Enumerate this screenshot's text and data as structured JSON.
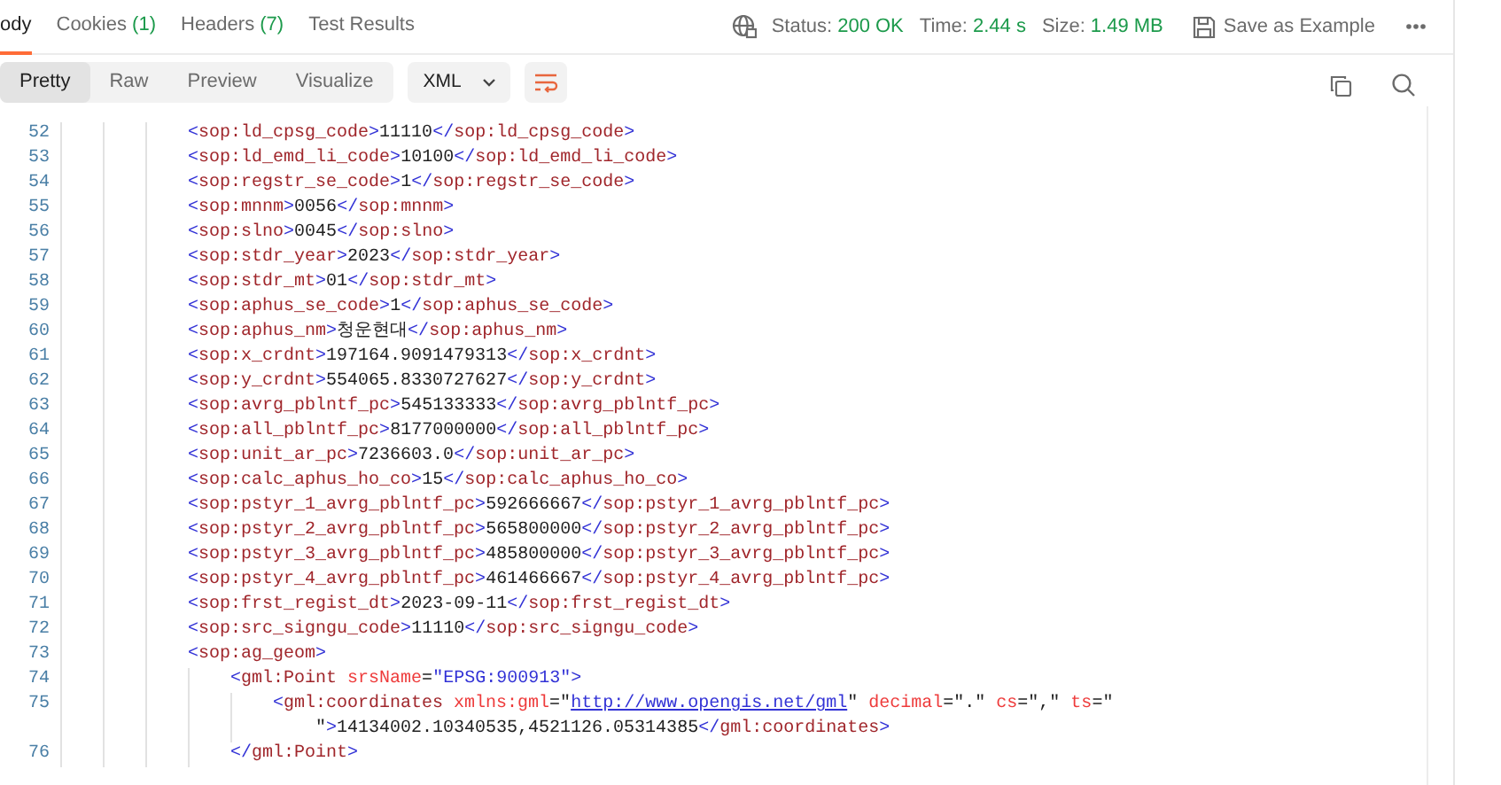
{
  "response_tabs": [
    {
      "label": "ody",
      "selected": true
    },
    {
      "label": "Cookies",
      "count": "(1)",
      "selected": false
    },
    {
      "label": "Headers",
      "count": "(7)",
      "selected": false
    },
    {
      "label": "Test Results",
      "selected": false
    }
  ],
  "status": [
    {
      "label": "Status:",
      "value": "200 OK"
    },
    {
      "label": "Time:",
      "value": "2.44 s"
    },
    {
      "label": "Size:",
      "value": "1.49 MB"
    }
  ],
  "save_button": "Save as Example",
  "view_modes": [
    {
      "label": "Pretty",
      "selected": true
    },
    {
      "label": "Raw",
      "selected": false
    },
    {
      "label": "Preview",
      "selected": false
    },
    {
      "label": "Visualize",
      "selected": false
    }
  ],
  "format": "XML",
  "wrap_lines": true,
  "code_lines": [
    {
      "number": "52",
      "tokens": [
        {
          "kind": "punct",
          "text": "<"
        },
        {
          "kind": "name",
          "text": "sop:ld_cpsg_code"
        },
        {
          "kind": "punct",
          "text": ">"
        },
        {
          "kind": "plain",
          "text": "11110"
        },
        {
          "kind": "punct",
          "text": "</"
        },
        {
          "kind": "name",
          "text": "sop:ld_cpsg_code"
        },
        {
          "kind": "punct",
          "text": ">"
        }
      ]
    },
    {
      "number": "53",
      "tokens": [
        {
          "kind": "punct",
          "text": "<"
        },
        {
          "kind": "name",
          "text": "sop:ld_emd_li_code"
        },
        {
          "kind": "punct",
          "text": ">"
        },
        {
          "kind": "plain",
          "text": "10100"
        },
        {
          "kind": "punct",
          "text": "</"
        },
        {
          "kind": "name",
          "text": "sop:ld_emd_li_code"
        },
        {
          "kind": "punct",
          "text": ">"
        }
      ]
    },
    {
      "number": "54",
      "tokens": [
        {
          "kind": "punct",
          "text": "<"
        },
        {
          "kind": "name",
          "text": "sop:regstr_se_code"
        },
        {
          "kind": "punct",
          "text": ">"
        },
        {
          "kind": "plain",
          "text": "1"
        },
        {
          "kind": "punct",
          "text": "</"
        },
        {
          "kind": "name",
          "text": "sop:regstr_se_code"
        },
        {
          "kind": "punct",
          "text": ">"
        }
      ]
    },
    {
      "number": "55",
      "tokens": [
        {
          "kind": "punct",
          "text": "<"
        },
        {
          "kind": "name",
          "text": "sop:mnnm"
        },
        {
          "kind": "punct",
          "text": ">"
        },
        {
          "kind": "plain",
          "text": "0056"
        },
        {
          "kind": "punct",
          "text": "</"
        },
        {
          "kind": "name",
          "text": "sop:mnnm"
        },
        {
          "kind": "punct",
          "text": ">"
        }
      ]
    },
    {
      "number": "56",
      "tokens": [
        {
          "kind": "punct",
          "text": "<"
        },
        {
          "kind": "name",
          "text": "sop:slno"
        },
        {
          "kind": "punct",
          "text": ">"
        },
        {
          "kind": "plain",
          "text": "0045"
        },
        {
          "kind": "punct",
          "text": "</"
        },
        {
          "kind": "name",
          "text": "sop:slno"
        },
        {
          "kind": "punct",
          "text": ">"
        }
      ]
    },
    {
      "number": "57",
      "tokens": [
        {
          "kind": "punct",
          "text": "<"
        },
        {
          "kind": "name",
          "text": "sop:stdr_year"
        },
        {
          "kind": "punct",
          "text": ">"
        },
        {
          "kind": "plain",
          "text": "2023"
        },
        {
          "kind": "punct",
          "text": "</"
        },
        {
          "kind": "name",
          "text": "sop:stdr_year"
        },
        {
          "kind": "punct",
          "text": ">"
        }
      ]
    },
    {
      "number": "58",
      "tokens": [
        {
          "kind": "punct",
          "text": "<"
        },
        {
          "kind": "name",
          "text": "sop:stdr_mt"
        },
        {
          "kind": "punct",
          "text": ">"
        },
        {
          "kind": "plain",
          "text": "01"
        },
        {
          "kind": "punct",
          "text": "</"
        },
        {
          "kind": "name",
          "text": "sop:stdr_mt"
        },
        {
          "kind": "punct",
          "text": ">"
        }
      ]
    },
    {
      "number": "59",
      "tokens": [
        {
          "kind": "punct",
          "text": "<"
        },
        {
          "kind": "name",
          "text": "sop:aphus_se_code"
        },
        {
          "kind": "punct",
          "text": ">"
        },
        {
          "kind": "plain",
          "text": "1"
        },
        {
          "kind": "punct",
          "text": "</"
        },
        {
          "kind": "name",
          "text": "sop:aphus_se_code"
        },
        {
          "kind": "punct",
          "text": ">"
        }
      ]
    },
    {
      "number": "60",
      "tokens": [
        {
          "kind": "punct",
          "text": "<"
        },
        {
          "kind": "name",
          "text": "sop:aphus_nm"
        },
        {
          "kind": "punct",
          "text": ">"
        },
        {
          "kind": "plain",
          "text": "청운현대"
        },
        {
          "kind": "punct",
          "text": "</"
        },
        {
          "kind": "name",
          "text": "sop:aphus_nm"
        },
        {
          "kind": "punct",
          "text": ">"
        }
      ]
    },
    {
      "number": "61",
      "tokens": [
        {
          "kind": "punct",
          "text": "<"
        },
        {
          "kind": "name",
          "text": "sop:x_crdnt"
        },
        {
          "kind": "punct",
          "text": ">"
        },
        {
          "kind": "plain",
          "text": "197164.9091479313"
        },
        {
          "kind": "punct",
          "text": "</"
        },
        {
          "kind": "name",
          "text": "sop:x_crdnt"
        },
        {
          "kind": "punct",
          "text": ">"
        }
      ]
    },
    {
      "number": "62",
      "tokens": [
        {
          "kind": "punct",
          "text": "<"
        },
        {
          "kind": "name",
          "text": "sop:y_crdnt"
        },
        {
          "kind": "punct",
          "text": ">"
        },
        {
          "kind": "plain",
          "text": "554065.8330727627"
        },
        {
          "kind": "punct",
          "text": "</"
        },
        {
          "kind": "name",
          "text": "sop:y_crdnt"
        },
        {
          "kind": "punct",
          "text": ">"
        }
      ]
    },
    {
      "number": "63",
      "tokens": [
        {
          "kind": "punct",
          "text": "<"
        },
        {
          "kind": "name",
          "text": "sop:avrg_pblntf_pc"
        },
        {
          "kind": "punct",
          "text": ">"
        },
        {
          "kind": "plain",
          "text": "545133333"
        },
        {
          "kind": "punct",
          "text": "</"
        },
        {
          "kind": "name",
          "text": "sop:avrg_pblntf_pc"
        },
        {
          "kind": "punct",
          "text": ">"
        }
      ]
    },
    {
      "number": "64",
      "tokens": [
        {
          "kind": "punct",
          "text": "<"
        },
        {
          "kind": "name",
          "text": "sop:all_pblntf_pc"
        },
        {
          "kind": "punct",
          "text": ">"
        },
        {
          "kind": "plain",
          "text": "8177000000"
        },
        {
          "kind": "punct",
          "text": "</"
        },
        {
          "kind": "name",
          "text": "sop:all_pblntf_pc"
        },
        {
          "kind": "punct",
          "text": ">"
        }
      ]
    },
    {
      "number": "65",
      "tokens": [
        {
          "kind": "punct",
          "text": "<"
        },
        {
          "kind": "name",
          "text": "sop:unit_ar_pc"
        },
        {
          "kind": "punct",
          "text": ">"
        },
        {
          "kind": "plain",
          "text": "7236603.0"
        },
        {
          "kind": "punct",
          "text": "</"
        },
        {
          "kind": "name",
          "text": "sop:unit_ar_pc"
        },
        {
          "kind": "punct",
          "text": ">"
        }
      ]
    },
    {
      "number": "66",
      "tokens": [
        {
          "kind": "punct",
          "text": "<"
        },
        {
          "kind": "name",
          "text": "sop:calc_aphus_ho_co"
        },
        {
          "kind": "punct",
          "text": ">"
        },
        {
          "kind": "plain",
          "text": "15"
        },
        {
          "kind": "punct",
          "text": "</"
        },
        {
          "kind": "name",
          "text": "sop:calc_aphus_ho_co"
        },
        {
          "kind": "punct",
          "text": ">"
        }
      ]
    },
    {
      "number": "67",
      "tokens": [
        {
          "kind": "punct",
          "text": "<"
        },
        {
          "kind": "name",
          "text": "sop:pstyr_1_avrg_pblntf_pc"
        },
        {
          "kind": "punct",
          "text": ">"
        },
        {
          "kind": "plain",
          "text": "592666667"
        },
        {
          "kind": "punct",
          "text": "</"
        },
        {
          "kind": "name",
          "text": "sop:pstyr_1_avrg_pblntf_pc"
        },
        {
          "kind": "punct",
          "text": ">"
        }
      ]
    },
    {
      "number": "68",
      "tokens": [
        {
          "kind": "punct",
          "text": "<"
        },
        {
          "kind": "name",
          "text": "sop:pstyr_2_avrg_pblntf_pc"
        },
        {
          "kind": "punct",
          "text": ">"
        },
        {
          "kind": "plain",
          "text": "565800000"
        },
        {
          "kind": "punct",
          "text": "</"
        },
        {
          "kind": "name",
          "text": "sop:pstyr_2_avrg_pblntf_pc"
        },
        {
          "kind": "punct",
          "text": ">"
        }
      ]
    },
    {
      "number": "69",
      "tokens": [
        {
          "kind": "punct",
          "text": "<"
        },
        {
          "kind": "name",
          "text": "sop:pstyr_3_avrg_pblntf_pc"
        },
        {
          "kind": "punct",
          "text": ">"
        },
        {
          "kind": "plain",
          "text": "485800000"
        },
        {
          "kind": "punct",
          "text": "</"
        },
        {
          "kind": "name",
          "text": "sop:pstyr_3_avrg_pblntf_pc"
        },
        {
          "kind": "punct",
          "text": ">"
        }
      ]
    },
    {
      "number": "70",
      "tokens": [
        {
          "kind": "punct",
          "text": "<"
        },
        {
          "kind": "name",
          "text": "sop:pstyr_4_avrg_pblntf_pc"
        },
        {
          "kind": "punct",
          "text": ">"
        },
        {
          "kind": "plain",
          "text": "461466667"
        },
        {
          "kind": "punct",
          "text": "</"
        },
        {
          "kind": "name",
          "text": "sop:pstyr_4_avrg_pblntf_pc"
        },
        {
          "kind": "punct",
          "text": ">"
        }
      ]
    },
    {
      "number": "71",
      "tokens": [
        {
          "kind": "punct",
          "text": "<"
        },
        {
          "kind": "name",
          "text": "sop:frst_regist_dt"
        },
        {
          "kind": "punct",
          "text": ">"
        },
        {
          "kind": "plain",
          "text": "2023-09-11"
        },
        {
          "kind": "punct",
          "text": "</"
        },
        {
          "kind": "name",
          "text": "sop:frst_regist_dt"
        },
        {
          "kind": "punct",
          "text": ">"
        }
      ]
    },
    {
      "number": "72",
      "tokens": [
        {
          "kind": "punct",
          "text": "<"
        },
        {
          "kind": "name",
          "text": "sop:src_signgu_code"
        },
        {
          "kind": "punct",
          "text": ">"
        },
        {
          "kind": "plain",
          "text": "11110"
        },
        {
          "kind": "punct",
          "text": "</"
        },
        {
          "kind": "name",
          "text": "sop:src_signgu_code"
        },
        {
          "kind": "punct",
          "text": ">"
        }
      ]
    },
    {
      "number": "73",
      "tokens": [
        {
          "kind": "punct",
          "text": "<"
        },
        {
          "kind": "name",
          "text": "sop:ag_geom"
        },
        {
          "kind": "punct",
          "text": ">"
        }
      ],
      "children": [
        {
          "number": "74",
          "tokens": [
            {
              "kind": "punct",
              "text": "<"
            },
            {
              "kind": "name",
              "text": "gml:Point"
            },
            {
              "kind": "attr",
              "text": " srsName"
            },
            {
              "kind": "plain",
              "text": "="
            },
            {
              "kind": "string",
              "text": "\"EPSG:900913\""
            },
            {
              "kind": "punct",
              "text": ">"
            }
          ],
          "children": [
            {
              "number": "75",
              "tokens": [
                {
                  "kind": "punct",
                  "text": "<"
                },
                {
                  "kind": "name",
                  "text": "gml:coordinates"
                },
                {
                  "kind": "attr",
                  "text": " xmlns:gml"
                },
                {
                  "kind": "plain",
                  "text": "=\""
                },
                {
                  "kind": "link",
                  "text": "http://www.opengis.net/gml"
                },
                {
                  "kind": "plain",
                  "text": "\" "
                },
                {
                  "kind": "attr",
                  "text": "decimal"
                },
                {
                  "kind": "plain",
                  "text": "=\".\" "
                },
                {
                  "kind": "attr",
                  "text": "cs"
                },
                {
                  "kind": "plain",
                  "text": "=\",\" "
                },
                {
                  "kind": "attr",
                  "text": "ts"
                },
                {
                  "kind": "plain",
                  "text": "=\" \""
                },
                {
                  "kind": "punct",
                  "text": ">"
                },
                {
                  "kind": "plain",
                  "text": "14134002.10340535,4521126.05314385"
                },
                {
                  "kind": "punct",
                  "text": "</"
                },
                {
                  "kind": "name",
                  "text": "gml:coordinates"
                },
                {
                  "kind": "punct",
                  "text": ">"
                }
              ]
            }
          ]
        },
        {
          "number": "76",
          "tokens": [
            {
              "kind": "punct",
              "text": "</"
            },
            {
              "kind": "name",
              "text": "gml:Point"
            },
            {
              "kind": "punct",
              "text": ">"
            }
          ]
        }
      ]
    }
  ]
}
